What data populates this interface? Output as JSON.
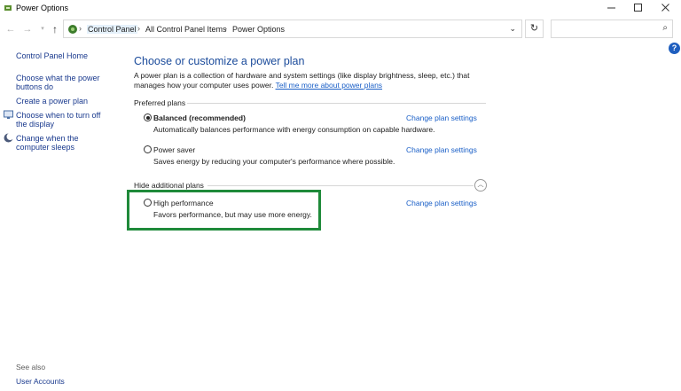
{
  "window": {
    "title": "Power Options",
    "icons": {
      "app": "power-options-icon",
      "minimize": "minimize-icon",
      "maximize": "maximize-icon",
      "close": "close-icon"
    }
  },
  "nav": {
    "breadcrumbs": [
      "Control Panel",
      "All Control Panel Items",
      "Power Options"
    ],
    "search_placeholder": "",
    "icons": {
      "back": "back-arrow-icon",
      "forward": "forward-arrow-icon",
      "recent": "chevron-down-icon",
      "up": "up-arrow-icon",
      "refresh": "refresh-icon",
      "search": "search-icon",
      "dropdown": "chevron-down-icon"
    }
  },
  "left_pane": {
    "home": "Control Panel Home",
    "items": [
      {
        "label": "Choose what the power buttons do",
        "icon": null
      },
      {
        "label": "Create a power plan",
        "icon": null
      },
      {
        "label": "Choose when to turn off the display",
        "icon": "monitor-icon"
      },
      {
        "label": "Change when the computer sleeps",
        "icon": "moon-icon"
      }
    ],
    "see_also": "See also",
    "user_accounts": "User Accounts"
  },
  "main": {
    "heading": "Choose or customize a power plan",
    "intro": "A power plan is a collection of hardware and system settings (like display brightness, sleep, etc.) that manages how your computer uses power.",
    "intro_link": "Tell me more about power plans",
    "preferred_label": "Preferred plans",
    "hidden_label": "Hide additional plans",
    "change_label": "Change plan settings",
    "plans": [
      {
        "name": "Balanced (recommended)",
        "desc": "Automatically balances performance with energy consumption on capable hardware.",
        "selected": true
      },
      {
        "name": "Power saver",
        "desc": "Saves energy by reducing your computer's performance where possible.",
        "selected": false
      },
      {
        "name": "High performance",
        "desc": "Favors performance, but may use more energy.",
        "selected": false
      }
    ]
  },
  "colors": {
    "heading": "#1b4b9b",
    "link": "#1a5fc7",
    "highlight": "#1f8a3a",
    "help": "#1f5fbf"
  }
}
